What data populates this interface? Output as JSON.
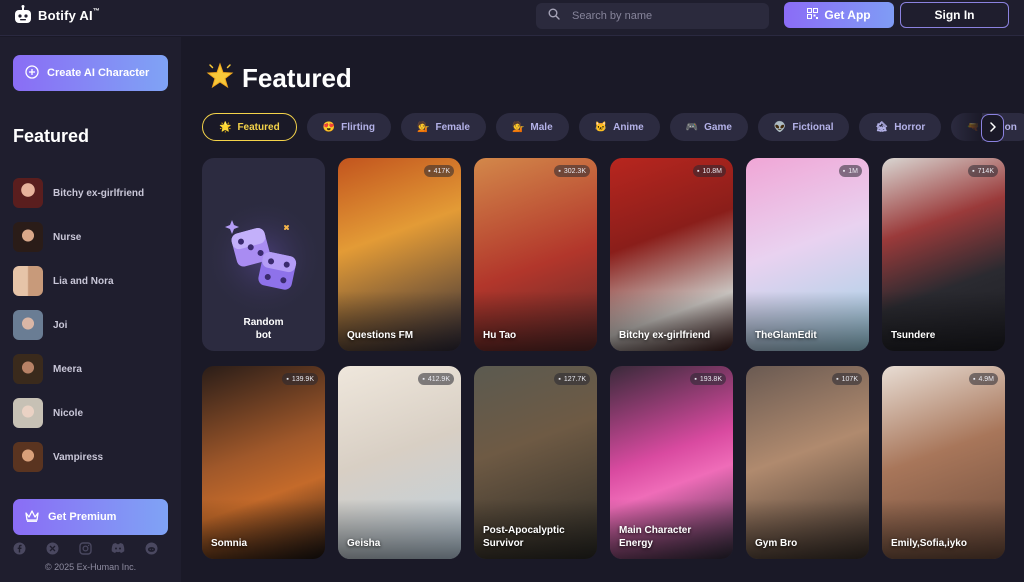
{
  "app": {
    "name": "Botify AI",
    "trademark": "™"
  },
  "header": {
    "search_placeholder": "Search by name",
    "get_app_label": "Get App",
    "sign_in_label": "Sign In"
  },
  "sidebar": {
    "create_label": "Create AI Character",
    "section_title": "Featured",
    "items": [
      {
        "label": "Bitchy ex-girlfriend"
      },
      {
        "label": "Nurse"
      },
      {
        "label": "Lia and Nora"
      },
      {
        "label": "Joi"
      },
      {
        "label": "Meera"
      },
      {
        "label": "Nicole"
      },
      {
        "label": "Vampiress"
      }
    ],
    "premium_label": "Get Premium",
    "socials": [
      "facebook-icon",
      "x-icon",
      "instagram-icon",
      "discord-icon",
      "reddit-icon"
    ],
    "copyright": "© 2025 Ex-Human Inc."
  },
  "main": {
    "title": "Featured",
    "title_emoji": "🌟",
    "chips": [
      {
        "emoji": "🌟",
        "label": "Featured",
        "active": true
      },
      {
        "emoji": "😍",
        "label": "Flirting"
      },
      {
        "emoji": "💁",
        "label": "Female"
      },
      {
        "emoji": "💁",
        "label": "Male"
      },
      {
        "emoji": "🐱",
        "label": "Anime"
      },
      {
        "emoji": "🎮",
        "label": "Game"
      },
      {
        "emoji": "👽",
        "label": "Fictional"
      },
      {
        "emoji": "🏚",
        "label": "Horror"
      },
      {
        "emoji": "🔫",
        "label": "Action"
      }
    ],
    "random_card": {
      "line1": "Random",
      "line2": "bot"
    },
    "cards": [
      {
        "label": "Questions FM",
        "count": "417K",
        "color1": "#c2541e",
        "color2": "#2e2a3a"
      },
      {
        "label": "Hu Tao",
        "count": "302.3K",
        "color1": "#d3884a",
        "color2": "#5a2a2a"
      },
      {
        "label": "Bitchy ex-girlfriend",
        "count": "10.8M",
        "color1": "#b8261f",
        "color2": "#3a1a1a"
      },
      {
        "label": "TheGlamEdit",
        "count": "1M",
        "color1": "#f0a6d6",
        "color2": "#9fd3e6"
      },
      {
        "label": "Tsundere",
        "count": "714K",
        "color1": "#d9d6d2",
        "color2": "#2a2a30"
      },
      {
        "label": "Somnia",
        "count": "139.9K",
        "color1": "#2a1d18",
        "color2": "#c46a2a"
      },
      {
        "label": "Geisha",
        "count": "412.9K",
        "color1": "#efe7dc",
        "color2": "#bcd0e0"
      },
      {
        "label": "Post-Apocalyptic Survivor",
        "count": "127.7K",
        "color1": "#5b5a50",
        "color2": "#2b2a25"
      },
      {
        "label": "Main Character Energy",
        "count": "193.8K",
        "color1": "#d94aa0",
        "color2": "#2e2a3a"
      },
      {
        "label": "Gym Bro",
        "count": "107K",
        "color1": "#6a5a52",
        "color2": "#3a302a"
      },
      {
        "label": "Emily,Sofia,iyko",
        "count": "4.9M",
        "color1": "#e8ddd4",
        "color2": "#6a4a3a"
      }
    ]
  },
  "colors": {
    "bg": "#1a1927",
    "panel": "#1f1e2e",
    "accent_start": "#8a6df5",
    "accent_end": "#7fa3f5",
    "chip_active": "#f4d34a"
  }
}
